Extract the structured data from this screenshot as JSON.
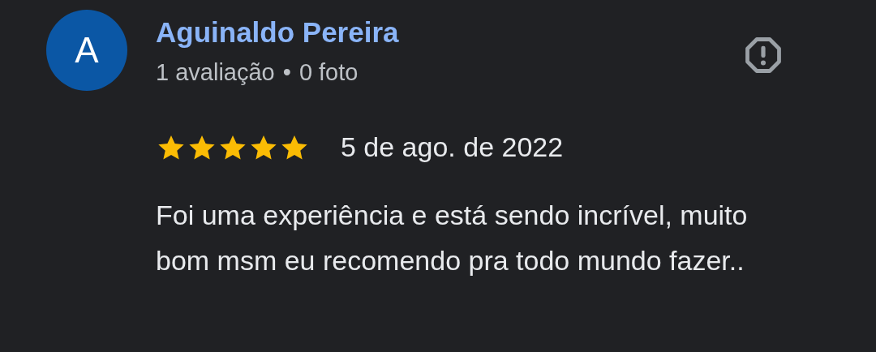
{
  "review": {
    "avatar_letter": "A",
    "author": "Aguinaldo Pereira",
    "reviews_count": "1 avaliação",
    "separator": "•",
    "photos_count": "0 foto",
    "stars": 5,
    "date": "5 de ago. de 2022",
    "text": "Foi uma experiência e está sendo incrível, muito bom msm eu recomendo pra todo mundo fazer.."
  }
}
